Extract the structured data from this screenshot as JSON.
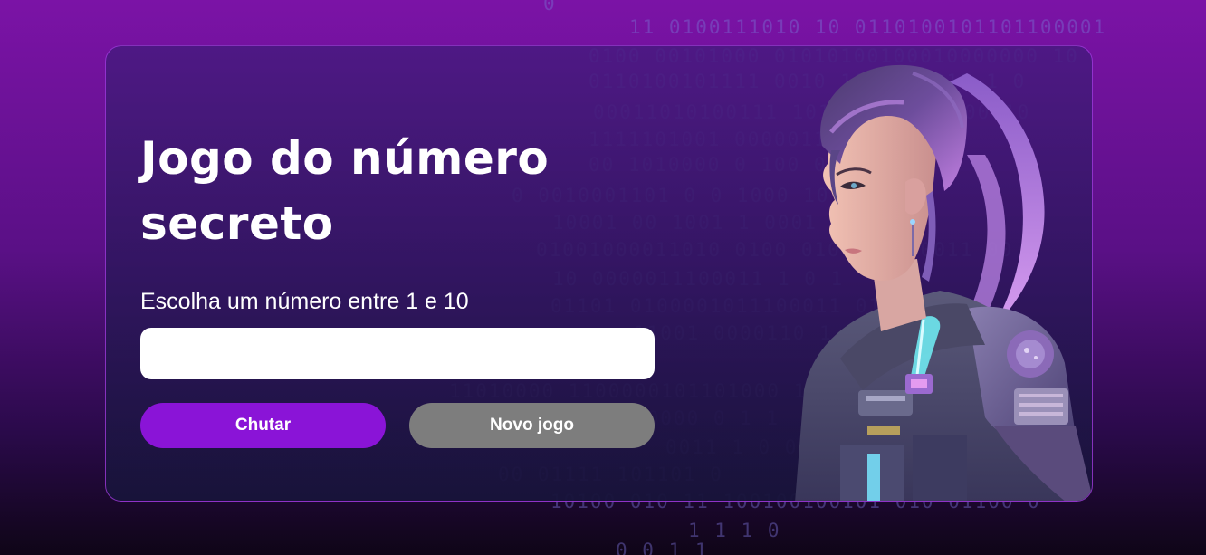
{
  "game": {
    "title_line1": "Jogo do número",
    "title_line2": "secreto",
    "prompt": "Escolha um número entre 1 e 10",
    "input_value": "",
    "guess_button_label": "Chutar",
    "new_game_button_label": "Novo jogo"
  },
  "background": {
    "binary_lines": [
      "0",
      "11 0100111010 10 0110100101101100001",
      "0100 00101000 01010100100010000000 10",
      "0110100101111 0010 1000211011 1 0",
      "00011010100111 10110 101101000010",
      "1111101001 0000011 0 0",
      "00 1010000 0 100 001011",
      "0 0010001101 0 0 1000 10 0",
      "10001 00 1001 1 0001 01",
      "01001000011010 0100 01000 0100011 00",
      "10 0000011100011 1 0 1",
      "01101 0100001011100011 01 01000",
      "11001 0000110 1 001 01000",
      "11010000 1100000101101000 11 10",
      "00000 0 1 1",
      "0011 1 0 0",
      "00 01111 101101 0",
      "10100 010 11 100100100101 010 01100 0",
      "1 1 1 0",
      "0 0 1 1"
    ]
  },
  "colors": {
    "guess_button": "#8a14d7",
    "new_game_button": "#7d7d7d",
    "card_border": "#aa3ce6",
    "page_background_top": "#7b13a6"
  },
  "icons": {
    "portrait": "cyberpunk-woman-illustration"
  }
}
